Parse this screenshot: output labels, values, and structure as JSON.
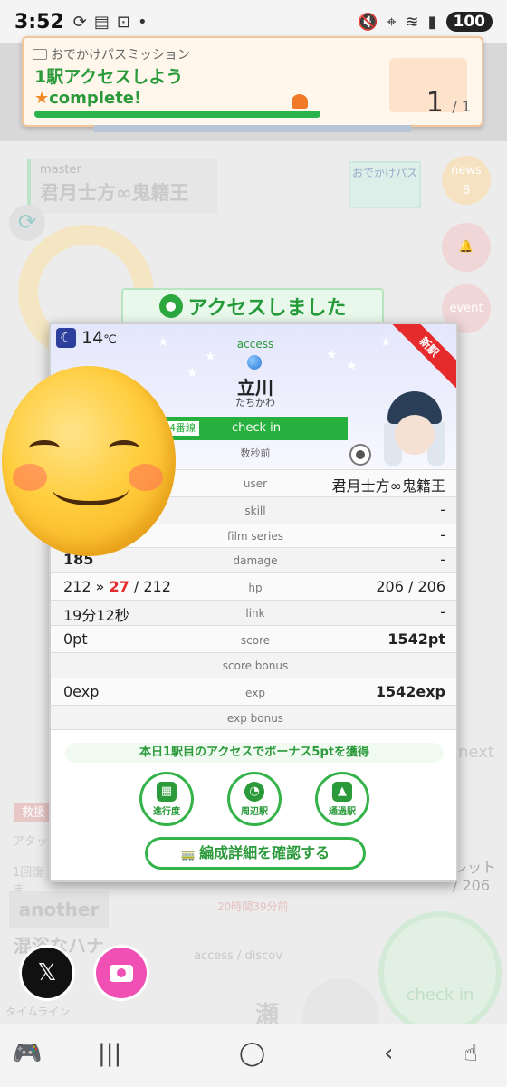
{
  "status_bar": {
    "time": "3:52",
    "battery": "100"
  },
  "notification": {
    "title": "おでかけパスミッション",
    "mission": "1駅アクセスしよう",
    "complete": "complete!",
    "progress": 1.0,
    "count": "1",
    "total": "/ 1"
  },
  "background": {
    "master_label": "master",
    "master_name": "君月士方∞鬼籍王",
    "odekake_pass": "おでかけパス",
    "news": "news",
    "news_count": "8",
    "event": "event",
    "next": "next",
    "ret": "レット",
    "ret_value": "/ 206",
    "kyu": "救援",
    "atta": "アタッ",
    "recover": "1回復ま",
    "logo": "another 混浴なハナ",
    "time20": "20時間39分前",
    "access_discover": "access / discov",
    "timeline": "タイムライン",
    "check_in_big": "check in",
    "seto": "瀬"
  },
  "accessed_header": "アクセスしました",
  "modal": {
    "temperature": "14",
    "temp_unit": "℃",
    "access_label": "access",
    "station_name": "立川",
    "station_kana": "たちかわ",
    "line_tag": "4番線",
    "checkin_label": "check in",
    "ago": "数秒前",
    "new_badge": "新駅",
    "rows": {
      "user_label": "user",
      "user_value": "君月士方∞鬼籍王",
      "skill_label": "skill",
      "skill_value": "-",
      "film_label": "film series",
      "film_value": "-",
      "damage_left": "185",
      "damage_label": "damage",
      "damage_value": "-",
      "hp_before": "212",
      "hp_arrow": "»",
      "hp_after": "27",
      "hp_max": "/ 212",
      "hp_label": "hp",
      "hp_value": "206 / 206",
      "link_left": "19分12秒",
      "link_label": "link",
      "link_value": "-",
      "score_left": "0pt",
      "score_label": "score",
      "score_value": "1542pt",
      "score_bonus_label": "score bonus",
      "exp_left": "0exp",
      "exp_label": "exp",
      "exp_value": "1542exp",
      "exp_bonus_label": "exp bonus"
    },
    "bonus_text": "本日1駅目のアクセスでボーナス5ptを獲得",
    "btn_progress": "進行度",
    "btn_nearby": "周辺駅",
    "btn_passed": "通過駅",
    "formation_btn": "編成詳細を確認する"
  },
  "colors": {
    "green": "#28a03a",
    "red": "#e52b2b",
    "accent_orange": "#f08a24"
  }
}
